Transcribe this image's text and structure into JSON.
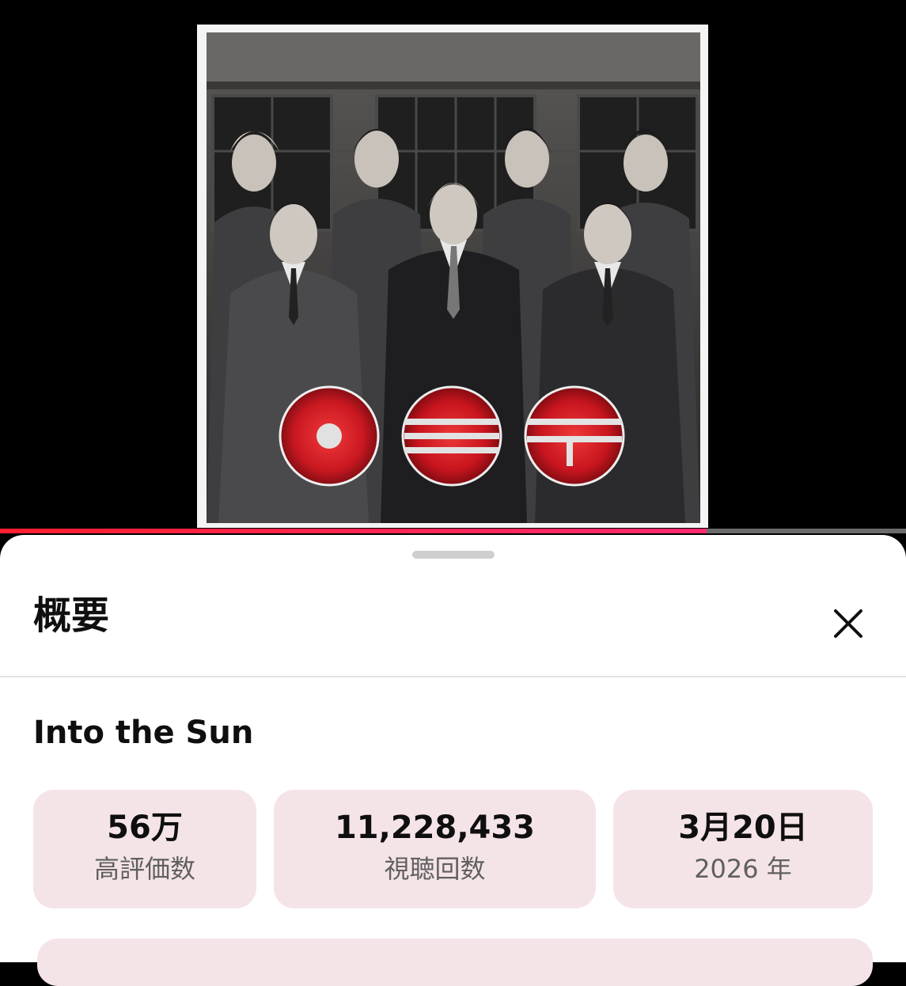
{
  "sheet": {
    "title": "概要",
    "close_icon": "close-icon"
  },
  "video": {
    "title": "Into the Sun",
    "progress_percent": 78
  },
  "stats": [
    {
      "value": "56万",
      "label": "高評価数"
    },
    {
      "value": "11,228,433",
      "label": "視聴回数"
    },
    {
      "value": "3月20日",
      "label": "2026 年"
    }
  ],
  "colors": {
    "accent": "#ff1f2f",
    "card_bg": "#f5e4e7",
    "logo_red": "#d6141e"
  }
}
